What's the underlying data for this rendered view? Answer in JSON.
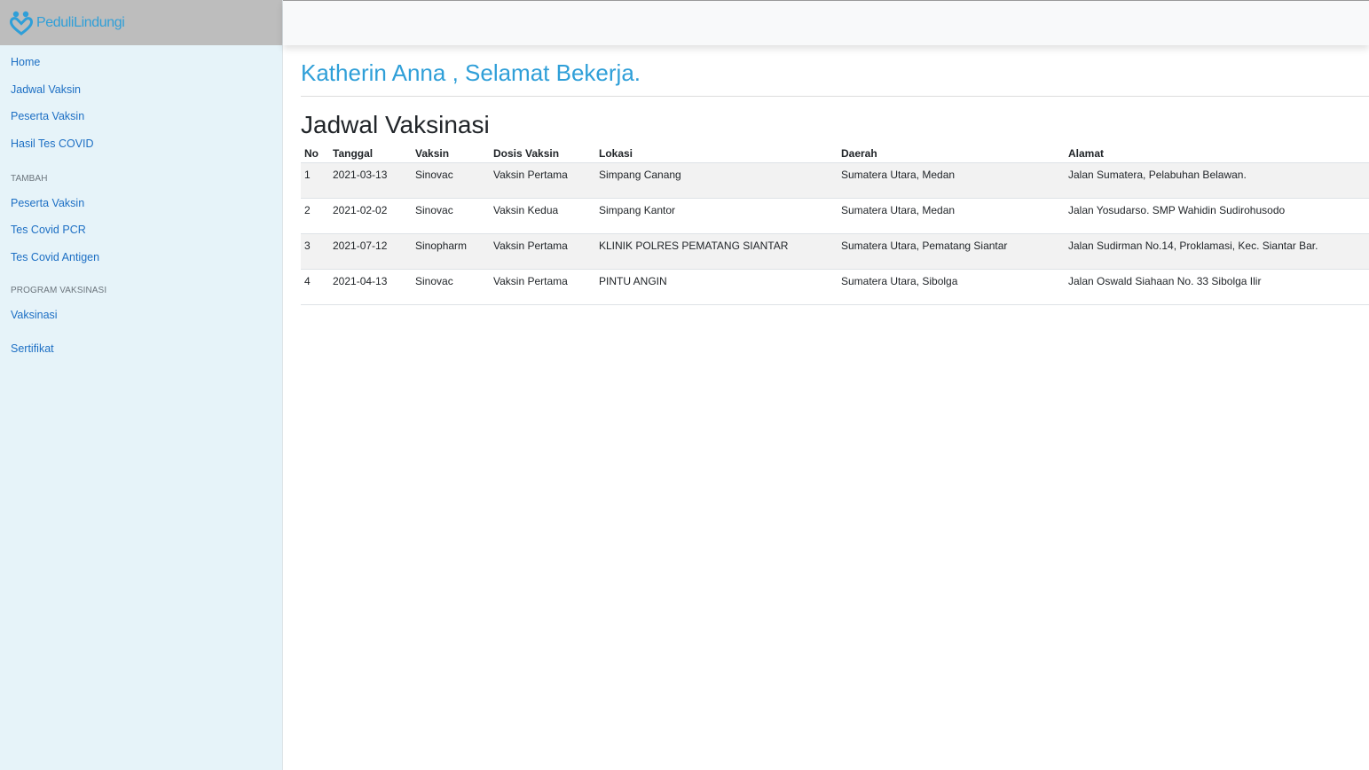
{
  "brand": {
    "name": "PeduliLindungi",
    "color": "#2f9fd8"
  },
  "sidebar": {
    "main_items": [
      {
        "label": "Home"
      },
      {
        "label": "Jadwal Vaksin"
      },
      {
        "label": "Peserta Vaksin"
      },
      {
        "label": "Hasil Tes COVID"
      }
    ],
    "section_tambah": "TAMBAH",
    "tambah_items": [
      {
        "label": "Peserta Vaksin"
      },
      {
        "label": "Tes Covid PCR"
      },
      {
        "label": "Tes Covid Antigen"
      }
    ],
    "section_program": "PROGRAM VAKSINASI",
    "program_items": [
      {
        "label": "Vaksinasi"
      },
      {
        "label": "Sertifikat"
      }
    ]
  },
  "main": {
    "greeting": "Katherin Anna , Selamat Bekerja.",
    "title": "Jadwal Vaksinasi"
  },
  "table": {
    "headers": [
      "No",
      "Tanggal",
      "Vaksin",
      "Dosis Vaksin",
      "Lokasi",
      "Daerah",
      "Alamat"
    ],
    "rows": [
      [
        "1",
        "2021-03-13",
        "Sinovac",
        "Vaksin Pertama",
        "Simpang Canang",
        "Sumatera Utara, Medan",
        "Jalan Sumatera, Pelabuhan Belawan."
      ],
      [
        "2",
        "2021-02-02",
        "Sinovac",
        "Vaksin Kedua",
        "Simpang Kantor",
        "Sumatera Utara, Medan",
        "Jalan Yosudarso. SMP Wahidin Sudirohusodo"
      ],
      [
        "3",
        "2021-07-12",
        "Sinopharm",
        "Vaksin Pertama",
        "KLINIK POLRES PEMATANG SIANTAR",
        "Sumatera Utara, Pematang Siantar",
        "Jalan Sudirman No.14, Proklamasi, Kec. Siantar Bar."
      ],
      [
        "4",
        "2021-04-13",
        "Sinovac",
        "Vaksin Pertama",
        "PINTU ANGIN",
        "Sumatera Utara, Sibolga",
        "Jalan Oswald Siahaan No. 33 Sibolga Ilir"
      ]
    ]
  }
}
